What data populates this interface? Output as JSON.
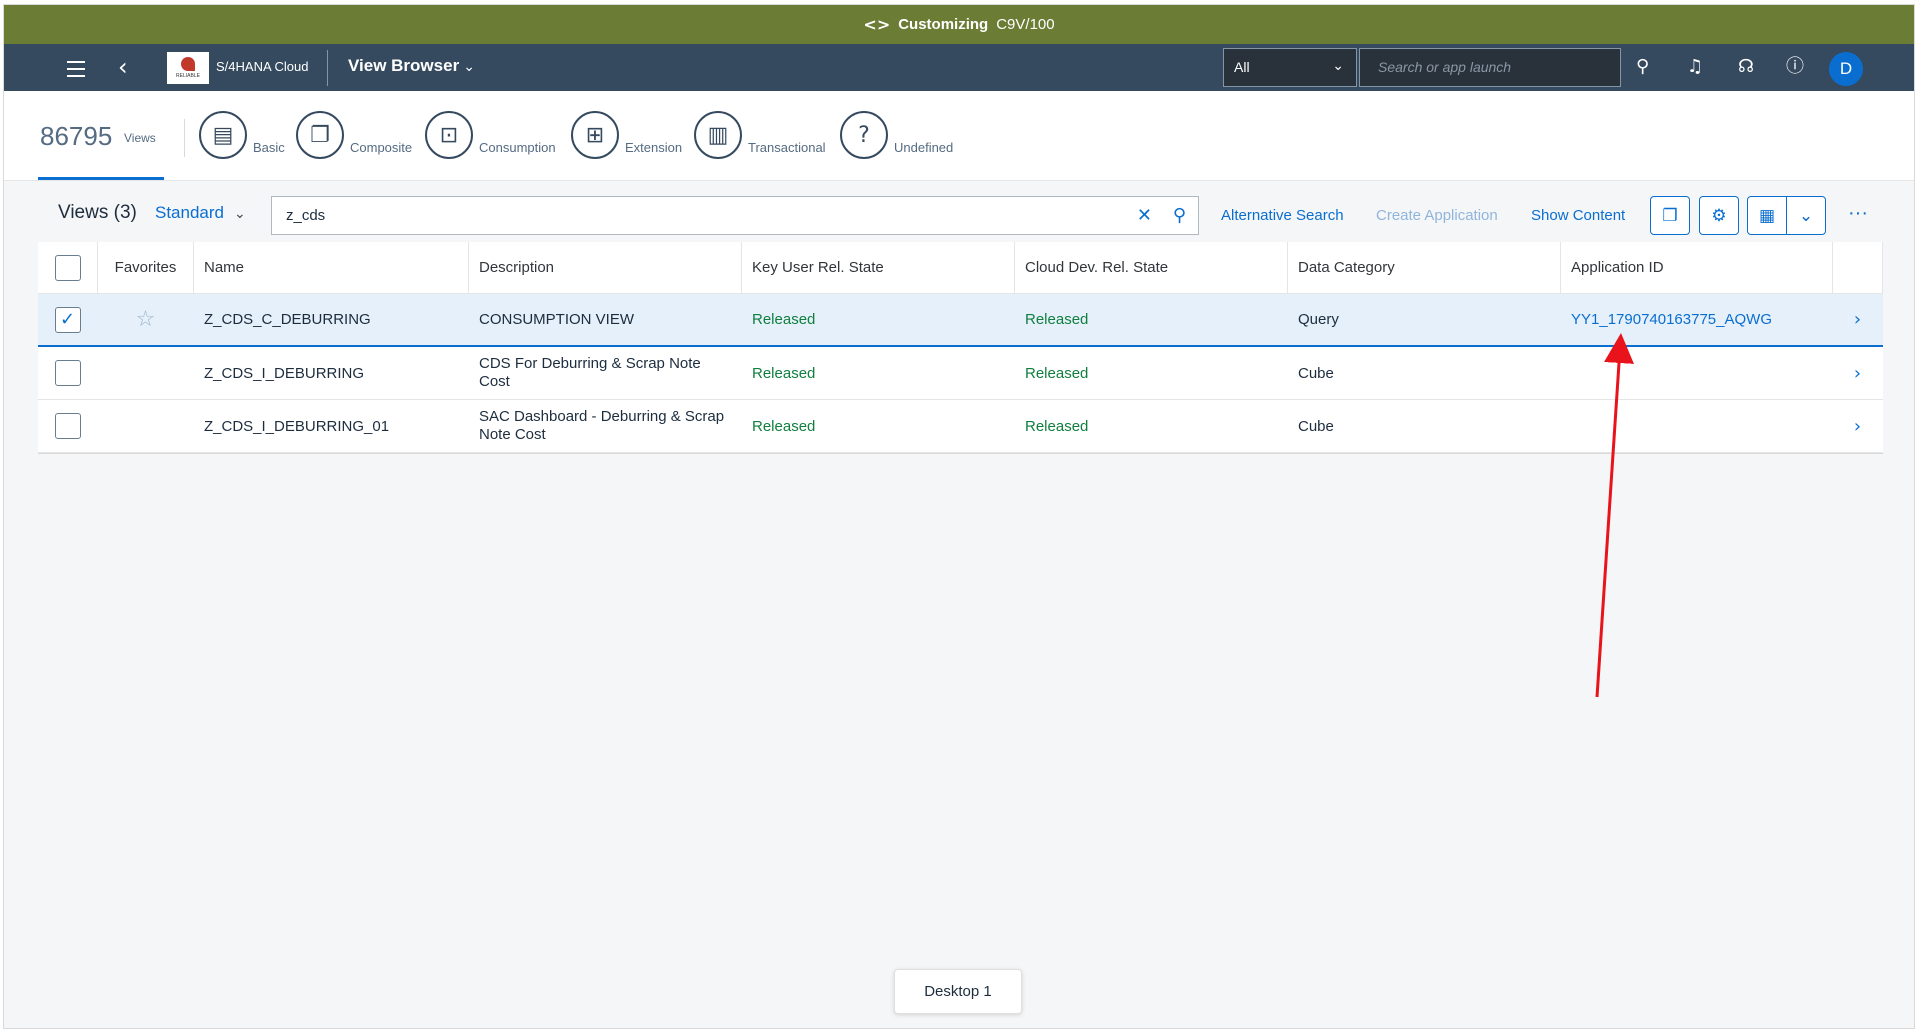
{
  "banner": {
    "label": "Customizing",
    "system": "C9V/100"
  },
  "shell": {
    "product": "S/4HANA Cloud",
    "logo_text": "RELIABLE",
    "app_title": "View Browser",
    "scope": "All",
    "search_placeholder": "Search or app launch",
    "avatar_initial": "D"
  },
  "header": {
    "count": "86795",
    "count_label": "Views",
    "categories": [
      {
        "label": "Basic",
        "icon": "document-icon"
      },
      {
        "label": "Composite",
        "icon": "documents-icon"
      },
      {
        "label": "Consumption",
        "icon": "unlock-icon"
      },
      {
        "label": "Extension",
        "icon": "add-document-icon"
      },
      {
        "label": "Transactional",
        "icon": "clipboard-icon"
      },
      {
        "label": "Undefined",
        "icon": "question-icon"
      }
    ]
  },
  "toolbar": {
    "views_title": "Views (3)",
    "variant": "Standard",
    "filter_value": "z_cds",
    "alternative_search": "Alternative Search",
    "create_application": "Create Application",
    "show_content": "Show Content"
  },
  "table": {
    "columns": [
      "Favorites",
      "Name",
      "Description",
      "Key User Rel. State",
      "Cloud Dev. Rel. State",
      "Data Category",
      "Application ID"
    ],
    "rows": [
      {
        "selected": true,
        "name": "Z_CDS_C_DEBURRING",
        "description": "CONSUMPTION VIEW",
        "key_user_state": "Released",
        "cloud_dev_state": "Released",
        "data_category": "Query",
        "application_id": "YY1_1790740163775_AQWG"
      },
      {
        "selected": false,
        "name": "Z_CDS_I_DEBURRING",
        "description": "CDS For Deburring & Scrap Note Cost",
        "key_user_state": "Released",
        "cloud_dev_state": "Released",
        "data_category": "Cube",
        "application_id": ""
      },
      {
        "selected": false,
        "name": "Z_CDS_I_DEBURRING_01",
        "description": "SAC Dashboard - Deburring & Scrap Note Cost",
        "key_user_state": "Released",
        "cloud_dev_state": "Released",
        "data_category": "Cube",
        "application_id": ""
      }
    ]
  },
  "desktop_label": "Desktop 1",
  "colors": {
    "banner": "#6b7c35",
    "shell": "#354a5f",
    "accent": "#0a6ed1",
    "released": "#107e3e",
    "annotation": "#e8131b"
  }
}
